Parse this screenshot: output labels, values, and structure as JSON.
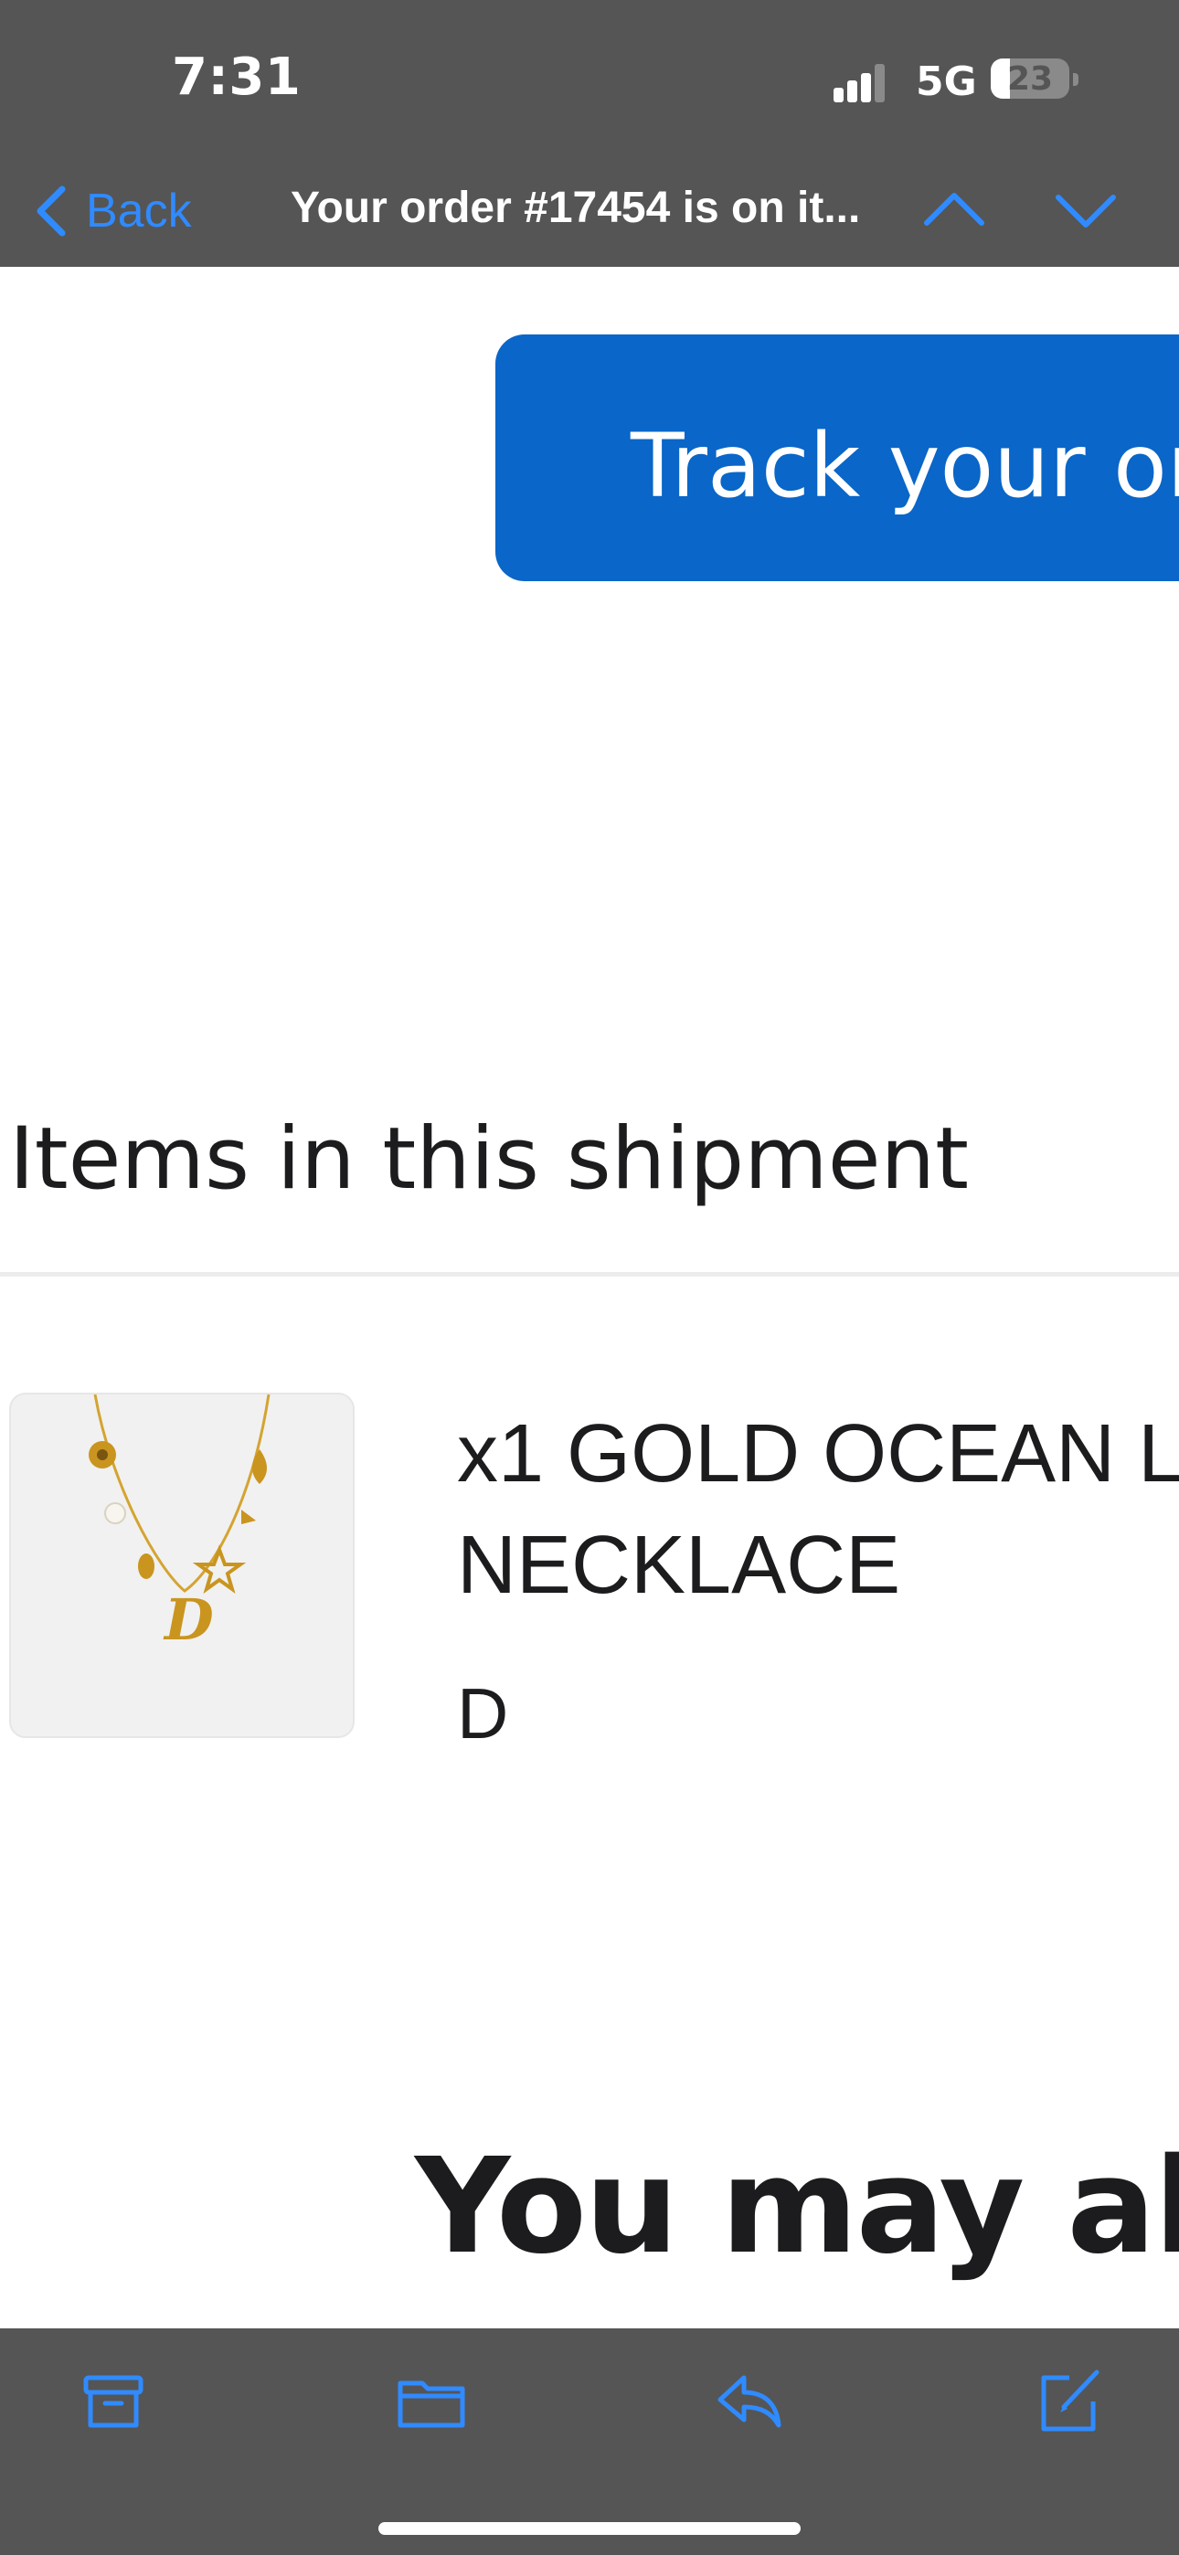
{
  "status_bar": {
    "time": "7:31",
    "network": "5G",
    "battery_level": "23",
    "signal_icon": "cellular-signal-icon"
  },
  "nav": {
    "back_label": "Back",
    "title": "Your order #17454 is on it...",
    "prev_icon": "chevron-up-icon",
    "next_icon": "chevron-down-icon",
    "accent_color": "#2f8bff"
  },
  "email": {
    "track_button_label": "Track your order",
    "section_heading": "Items in this shipment",
    "items": [
      {
        "title_line1": "x1 GOLD OCEAN L",
        "title_line2": "NECKLACE",
        "variant": "D",
        "thumbnail_icon": "gold-charm-necklace-image"
      }
    ],
    "promo_heading": "You may also",
    "button_color": "#0a66c8"
  },
  "toolbar": {
    "items": [
      {
        "icon": "archive-icon"
      },
      {
        "icon": "folder-icon"
      },
      {
        "icon": "reply-icon"
      },
      {
        "icon": "compose-icon"
      }
    ]
  }
}
